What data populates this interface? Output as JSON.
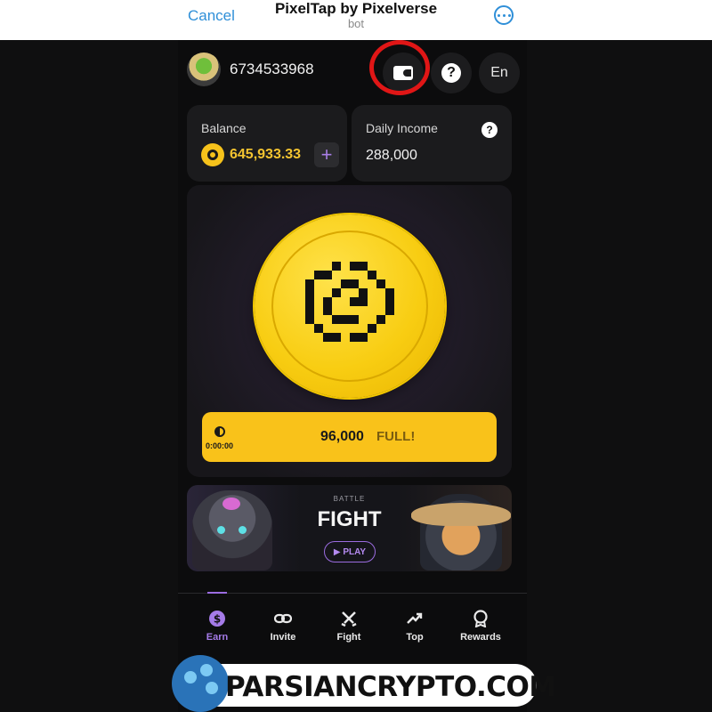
{
  "header": {
    "cancel_label": "Cancel",
    "title": "PixelTap by Pixelverse",
    "subtitle": "bot"
  },
  "profile": {
    "user_id": "6734533968",
    "language_label": "En"
  },
  "balance": {
    "label": "Balance",
    "value": "645,933.33",
    "add_label": "+"
  },
  "income": {
    "label": "Daily Income",
    "value": "288,000",
    "help_label": "?"
  },
  "energy": {
    "timer": "0:00:00",
    "value": "96,000",
    "status": "FULL!"
  },
  "battle": {
    "label": "BATTLE",
    "title": "FIGHT",
    "play_label": "▶ PLAY"
  },
  "nav": {
    "items": [
      {
        "label": "Earn",
        "icon": "dollar-icon"
      },
      {
        "label": "Invite",
        "icon": "link-icon"
      },
      {
        "label": "Fight",
        "icon": "swords-icon"
      },
      {
        "label": "Top",
        "icon": "trend-icon"
      },
      {
        "label": "Rewards",
        "icon": "medal-icon"
      }
    ]
  },
  "watermark": {
    "text": "PARSIANCRYPTO.COM"
  },
  "colors": {
    "accent_yellow": "#f9c21a",
    "accent_purple": "#9b6ce0",
    "telegram_blue": "#2f8fd8",
    "highlight_red": "#e01616"
  }
}
